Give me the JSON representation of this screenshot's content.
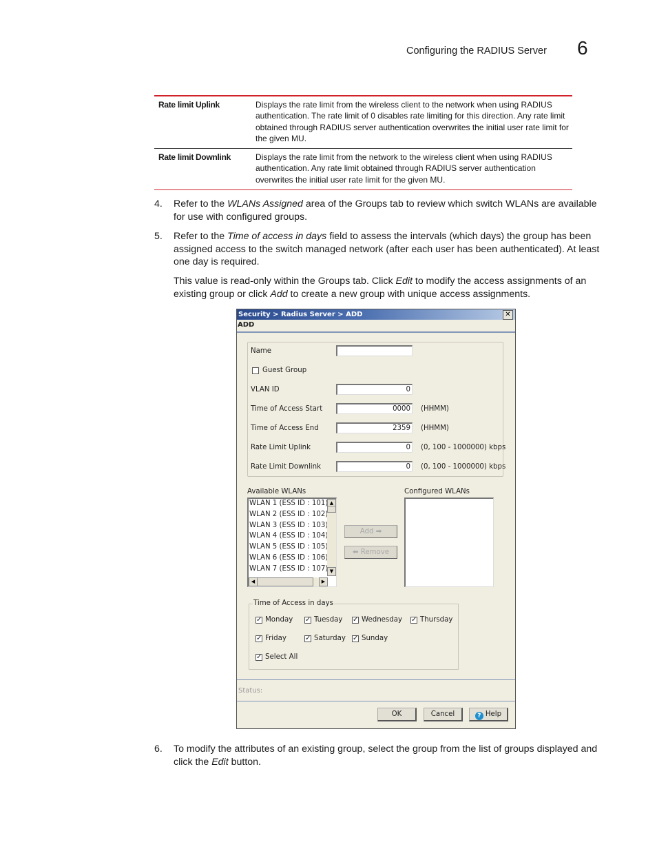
{
  "header": {
    "section_title": "Configuring the RADIUS Server",
    "chapter_number": "6"
  },
  "table": {
    "rows": [
      {
        "term": "Rate limit Uplink",
        "description": "Displays the rate limit from the wireless client to the network when using RADIUS authentication. The rate limit of 0 disables rate limiting for this direction. Any rate limit obtained through RADIUS server authentication overwrites the initial user rate limit for the given MU."
      },
      {
        "term": "Rate limit Downlink",
        "description": "Displays the rate limit from the network to the wireless client when using RADIUS authentication. Any rate limit obtained through RADIUS server authentication overwrites the initial user rate limit for the given MU."
      }
    ]
  },
  "steps": {
    "s4": {
      "num": "4.",
      "pre": "Refer to the ",
      "em": "WLANs Assigned",
      "post": " area of the Groups tab to review which switch WLANs are available for use with configured groups."
    },
    "s5": {
      "num": "5.",
      "pre": "Refer to the ",
      "em": "Time of access in days",
      "post": " field to assess the intervals (which days) the group has been assigned access to the switch managed network (after each user has been authenticated). At least one day is required."
    },
    "s5_note": {
      "a": "This value is read-only within the Groups tab. Click ",
      "em1": "Edit",
      "b": " to modify the access assignments of an existing group or click ",
      "em2": "Add",
      "c": " to create a new group with unique access assignments."
    },
    "s6": {
      "num": "6.",
      "pre": "To modify the attributes of an existing group, select the group from the list of groups displayed and click the ",
      "em": "Edit",
      "post": " button."
    }
  },
  "dialog": {
    "title": "Security > Radius Server > ADD",
    "close_glyph": "✕",
    "subtitle": "ADD",
    "fields": {
      "name": {
        "label": "Name",
        "value": ""
      },
      "guest_group": {
        "label": "Guest Group",
        "checked": false
      },
      "vlan_id": {
        "label": "VLAN ID",
        "value": "0"
      },
      "time_start": {
        "label": "Time of Access Start",
        "value": "0000",
        "hint": "(HHMM)"
      },
      "time_end": {
        "label": "Time of Access End",
        "value": "2359",
        "hint": "(HHMM)"
      },
      "rate_uplink": {
        "label": "Rate Limit Uplink",
        "value": "0",
        "hint": "(0, 100 - 1000000) kbps"
      },
      "rate_downlink": {
        "label": "Rate Limit Downlink",
        "value": "0",
        "hint": "(0, 100 - 1000000) kbps"
      }
    },
    "available_wlans": {
      "label": "Available WLANs",
      "items": [
        "WLAN 1 (ESS ID : 101)",
        "WLAN 2 (ESS ID : 102)",
        "WLAN 3 (ESS ID : 103)",
        "WLAN 4 (ESS ID : 104)",
        "WLAN 5 (ESS ID : 105)",
        "WLAN 6 (ESS ID : 106)",
        "WLAN 7 (ESS ID : 107)"
      ]
    },
    "configured_wlans": {
      "label": "Configured WLANs",
      "items": []
    },
    "add_button": "Add ➡",
    "remove_button": "⬅ Remove",
    "days": {
      "legend": "Time of Access in days",
      "items": [
        {
          "label": "Monday",
          "checked": true
        },
        {
          "label": "Tuesday",
          "checked": true
        },
        {
          "label": "Wednesday",
          "checked": true
        },
        {
          "label": "Thursday",
          "checked": true
        },
        {
          "label": "Friday",
          "checked": true
        },
        {
          "label": "Saturday",
          "checked": true
        },
        {
          "label": "Sunday",
          "checked": true
        },
        {
          "label": "Select All",
          "checked": true
        }
      ]
    },
    "status_label": "Status:",
    "buttons": {
      "ok": "OK",
      "cancel": "Cancel",
      "help": "Help"
    },
    "check_glyph": "✓"
  }
}
